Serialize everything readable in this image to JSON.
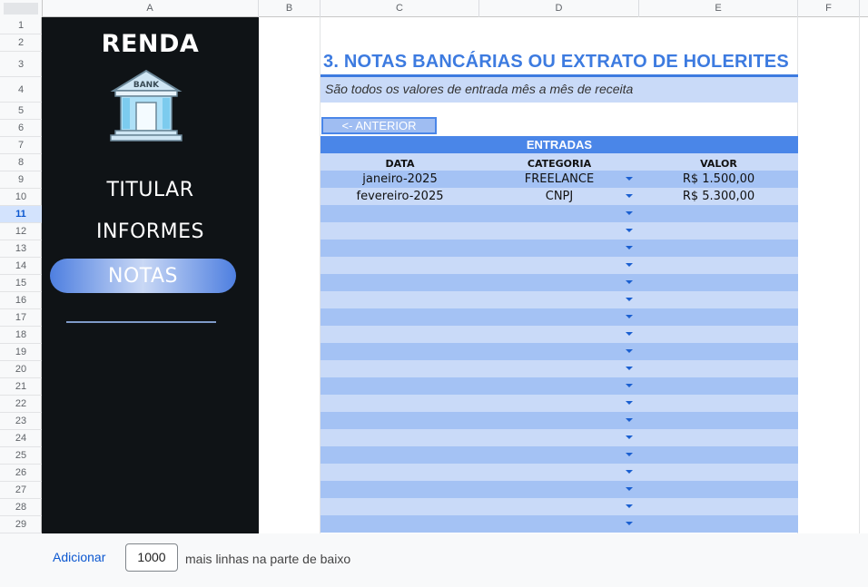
{
  "columns": [
    "A",
    "B",
    "C",
    "D",
    "E",
    "F"
  ],
  "rows": [
    "1",
    "2",
    "3",
    "4",
    "5",
    "6",
    "7",
    "8",
    "9",
    "10",
    "11",
    "12",
    "13",
    "14",
    "15",
    "16",
    "17",
    "18",
    "19",
    "20",
    "21",
    "22",
    "23",
    "24",
    "25",
    "26",
    "27",
    "28",
    "29"
  ],
  "selected_row": "11",
  "sidebar": {
    "title": "RENDA",
    "logo_text": "BANK",
    "icon": "bank-icon",
    "items": [
      {
        "label": "TITULAR",
        "active": false
      },
      {
        "label": "INFORMES",
        "active": false
      },
      {
        "label": "NOTAS",
        "active": true
      }
    ]
  },
  "content": {
    "heading": "3. NOTAS BANCÁRIAS OU EXTRATO DE HOLERITES",
    "subtitle": "São todos os valores de entrada mês a mês de receita",
    "prev_button": "<- ANTERIOR",
    "table": {
      "title": "ENTRADAS",
      "headers": [
        "DATA",
        "CATEGORIA",
        "VALOR"
      ],
      "rows": [
        {
          "data": "janeiro-2025",
          "categoria": "FREELANCE",
          "valor": "R$ 1.500,00"
        },
        {
          "data": "fevereiro-2025",
          "categoria": "CNPJ",
          "valor": "R$ 5.300,00"
        },
        {
          "data": "",
          "categoria": "",
          "valor": ""
        },
        {
          "data": "",
          "categoria": "",
          "valor": ""
        },
        {
          "data": "",
          "categoria": "",
          "valor": ""
        },
        {
          "data": "",
          "categoria": "",
          "valor": ""
        },
        {
          "data": "",
          "categoria": "",
          "valor": ""
        },
        {
          "data": "",
          "categoria": "",
          "valor": ""
        },
        {
          "data": "",
          "categoria": "",
          "valor": ""
        },
        {
          "data": "",
          "categoria": "",
          "valor": ""
        },
        {
          "data": "",
          "categoria": "",
          "valor": ""
        },
        {
          "data": "",
          "categoria": "",
          "valor": ""
        },
        {
          "data": "",
          "categoria": "",
          "valor": ""
        },
        {
          "data": "",
          "categoria": "",
          "valor": ""
        },
        {
          "data": "",
          "categoria": "",
          "valor": ""
        },
        {
          "data": "",
          "categoria": "",
          "valor": ""
        },
        {
          "data": "",
          "categoria": "",
          "valor": ""
        },
        {
          "data": "",
          "categoria": "",
          "valor": ""
        },
        {
          "data": "",
          "categoria": "",
          "valor": ""
        },
        {
          "data": "",
          "categoria": "",
          "valor": ""
        },
        {
          "data": "",
          "categoria": "",
          "valor": ""
        }
      ]
    }
  },
  "bottom": {
    "add_label": "Adicionar",
    "rows_value": "1000",
    "suffix": "mais linhas na parte de baixo"
  },
  "colors": {
    "sidebar_bg": "#0f1316",
    "accent": "#4a86e8",
    "row_light": "#c9daf8",
    "row_dark": "#a4c2f4"
  }
}
